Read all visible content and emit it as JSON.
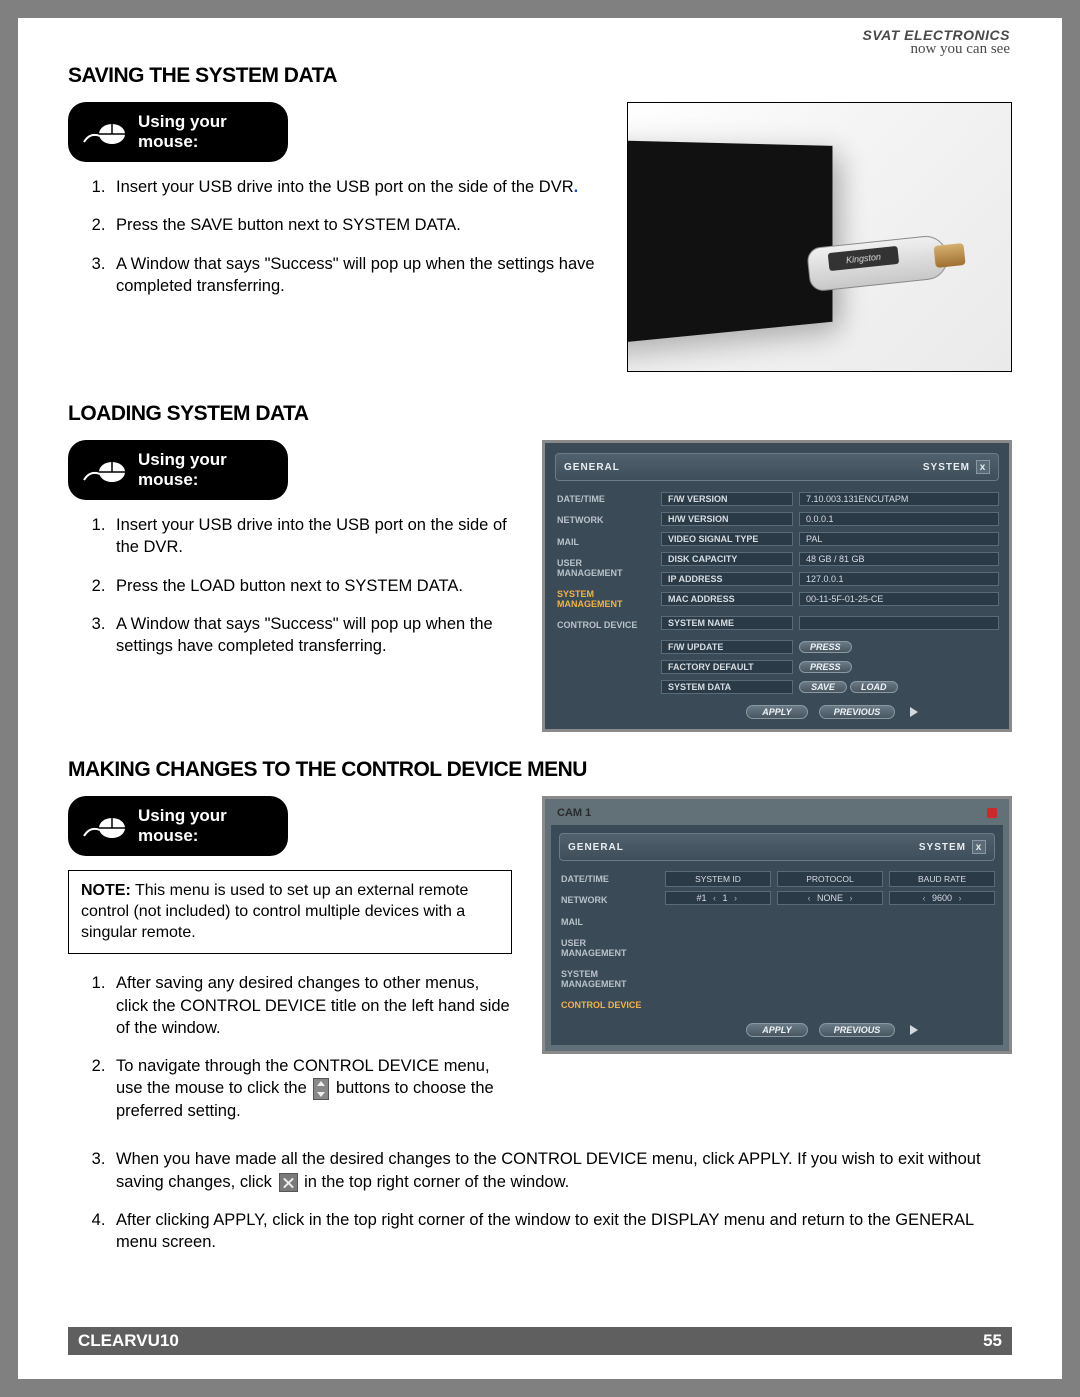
{
  "brand": {
    "company": "SVAT ELECTRONICS",
    "tagline": "now you can see"
  },
  "footer": {
    "product": "CLEARVU10",
    "page": "55"
  },
  "usb_label": "Kingston",
  "mouse_badge": {
    "line1": "Using your",
    "line2": "mouse:"
  },
  "section_saving": {
    "title": "SAVING THE SYSTEM DATA",
    "steps": [
      "Insert your USB drive into the USB port on the side of the DVR",
      "Press the SAVE button next to SYSTEM DATA.",
      "A Window that says \"Success\" will pop up when the settings have completed transferring."
    ]
  },
  "section_loading": {
    "title": "LOADING SYSTEM DATA",
    "steps": [
      "Insert your USB drive into the USB port on the side of the DVR.",
      "Press the LOAD button next to SYSTEM DATA.",
      "A Window that says \"Success\" will pop up when the settings have completed transferring."
    ]
  },
  "section_control": {
    "title": "MAKING CHANGES TO THE CONTROL DEVICE MENU",
    "note_label": "NOTE:",
    "note_text": "This menu is used to set up an external remote control (not included) to control multiple devices with a singular remote.",
    "steps_a": [
      "After saving any desired changes to other menus, click the CONTROL DEVICE title on the left hand side of the window."
    ],
    "step2_a": "To navigate through the CONTROL DEVICE menu, use the mouse to click the ",
    "step2_b": " buttons to choose the preferred setting.",
    "step3_a": "When you have made all the desired changes to the CONTROL DEVICE menu, click APPLY.  If you wish to exit without saving changes, click ",
    "step3_b": " in the top right corner of the window.",
    "step4": "After clicking APPLY, click   in the top right corner of the window to exit the DISPLAY menu and return to the GENERAL menu screen."
  },
  "dvr_system": {
    "toolbar_left": "GENERAL",
    "toolbar_right": "SYSTEM",
    "nav": [
      "DATE/TIME",
      "NETWORK",
      "MAIL",
      "USER MANAGEMENT",
      "SYSTEM MANAGEMENT",
      "CONTROL DEVICE"
    ],
    "nav_active_index": 4,
    "rows": [
      {
        "field": "F/W VERSION",
        "value": "7.10.003.131ENCUTAPM"
      },
      {
        "field": "H/W VERSION",
        "value": "0.0.0.1"
      },
      {
        "field": "VIDEO SIGNAL TYPE",
        "value": "PAL"
      },
      {
        "field": "DISK CAPACITY",
        "value": "48 GB / 81 GB"
      },
      {
        "field": "IP ADDRESS",
        "value": "127.0.0.1"
      },
      {
        "field": "MAC ADDRESS",
        "value": "00-11-5F-01-25-CE"
      }
    ],
    "sys_name_field": "SYSTEM NAME",
    "fw_update_field": "F/W UPDATE",
    "factory_field": "FACTORY DEFAULT",
    "sysdata_field": "SYSTEM DATA",
    "press": "PRESS",
    "save": "SAVE",
    "load": "LOAD",
    "apply": "APPLY",
    "previous": "PREVIOUS"
  },
  "dvr_control": {
    "cam_label": "CAM 1",
    "toolbar_left": "GENERAL",
    "toolbar_right": "SYSTEM",
    "nav": [
      "DATE/TIME",
      "NETWORK",
      "MAIL",
      "USER MANAGEMENT",
      "SYSTEM MANAGEMENT",
      "CONTROL DEVICE"
    ],
    "nav_active_index": 5,
    "headers": [
      "SYSTEM ID",
      "PROTOCOL",
      "BAUD RATE"
    ],
    "values": {
      "system_id_prefix": "#1",
      "system_id": "1",
      "protocol": "NONE",
      "baud": "9600"
    },
    "apply": "APPLY",
    "previous": "PREVIOUS"
  }
}
